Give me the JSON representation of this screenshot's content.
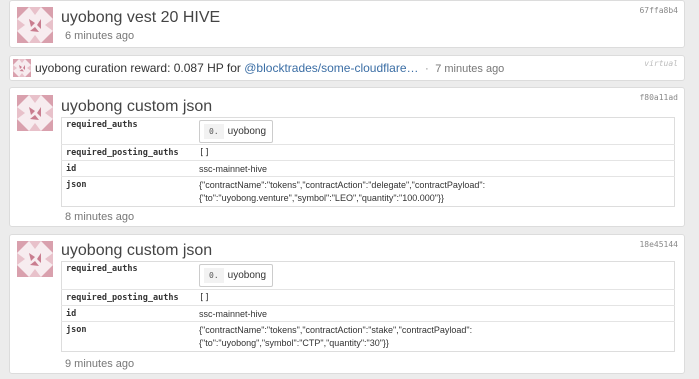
{
  "ops": [
    {
      "title": "uyobong vest 20 HIVE",
      "trx_id": "67ffa8b4",
      "time": "6 minutes ago"
    },
    {
      "trx_id": "virtual",
      "prefix": "uyobong curation reward: 0.087 HP for",
      "link": "@blocktrades/some-cloudflare…",
      "separator": "·",
      "time": "7 minutes ago"
    },
    {
      "title": "uyobong custom json",
      "trx_id": "f80a11ad",
      "required_auths_key": "required_auths",
      "auth_index": "0.",
      "auth_value": "uyobong",
      "posting_key": "required_posting_auths",
      "posting_value": "[]",
      "id_key": "id",
      "id_value": "ssc-mainnet-hive",
      "json_key": "json",
      "json_line1": "{\"contractName\":\"tokens\",\"contractAction\":\"delegate\",\"contractPayload\":",
      "json_line2": "{\"to\":\"uyobong.venture\",\"symbol\":\"LEO\",\"quantity\":\"100.000\"}}",
      "time": "8 minutes ago"
    },
    {
      "title": "uyobong custom json",
      "trx_id": "18e45144",
      "required_auths_key": "required_auths",
      "auth_index": "0.",
      "auth_value": "uyobong",
      "posting_key": "required_posting_auths",
      "posting_value": "[]",
      "id_key": "id",
      "id_value": "ssc-mainnet-hive",
      "json_key": "json",
      "json_line1": "{\"contractName\":\"tokens\",\"contractAction\":\"stake\",\"contractPayload\":",
      "json_line2": "{\"to\":\"uyobong\",\"symbol\":\"CTP\",\"quantity\":\"30\"}}",
      "time": "9 minutes ago"
    }
  ],
  "colors": {
    "link": "#3b6ea5",
    "avatar": "#d9a0ad"
  }
}
